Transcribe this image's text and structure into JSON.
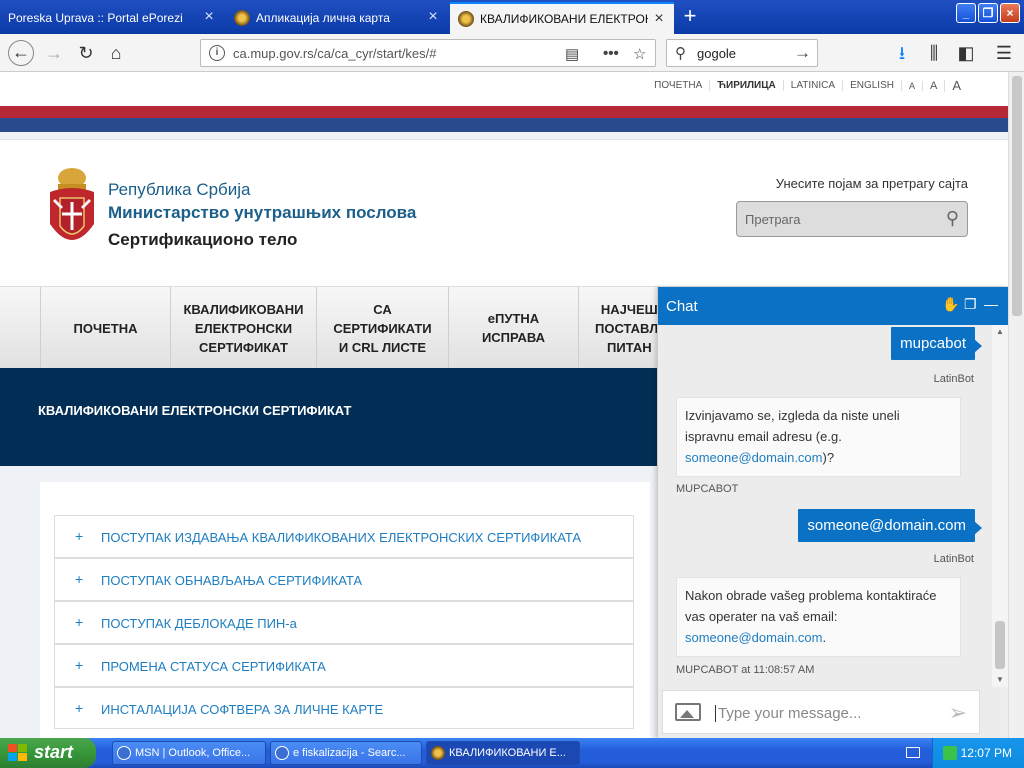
{
  "browser": {
    "tabs": [
      {
        "label": "Poreska Uprava :: Portal ePorezi",
        "active": false
      },
      {
        "label": "Апликација лична карта",
        "active": false
      },
      {
        "label": "КВАЛИФИКОВАНИ ЕЛЕКТРОНСКИ",
        "active": true
      }
    ],
    "url": "ca.mup.gov.rs/ca/ca_cyr/start/kes/#",
    "search_value": "gogole"
  },
  "page": {
    "toplinks": [
      "ПОЧЕТНА",
      "ЋИРИЛИЦА",
      "LATINICA",
      "ENGLISH",
      "A",
      "A",
      "A"
    ],
    "header": {
      "line1": "Република Србија",
      "line2": "Министарство унутрашњих послова",
      "line3": "Сертификационо тело"
    },
    "site_search": {
      "label": "Унесите појам за претрагу сајта",
      "placeholder": "Претрага"
    },
    "nav": [
      "ПОЧЕТНА",
      "КВАЛИФИКОВАНИ\nЕЛЕКТРОНСКИ\nСЕРТИФИКАТ",
      "СА\nСЕРТИФИКАТИ\nИ CRL ЛИСТЕ",
      "еПУТНА\nИСПРАВА",
      "НАЈЧЕШ\nПОСТАВЉ\nПИТАН"
    ],
    "banner_title": "КВАЛИФИКОВАНИ ЕЛЕКТРОНСКИ СЕРТИФИКАТ",
    "accordion": [
      "ПОСТУПАК ИЗДАВАЊА КВАЛИФИКОВАНИХ ЕЛЕКТРОНСКИХ СЕРТИФИКАТА",
      "ПОСТУПАК ОБНАВЉАЊА СЕРТИФИКАТА",
      "ПОСТУПАК ДЕБЛОКАДЕ ПИН-а",
      "ПРОМЕНА СТАТУСА СЕРТИФИКАТА",
      "ИНСТАЛАЦИЈА СОФТВЕРА ЗА ЛИЧНЕ КАРТЕ"
    ],
    "accordion_symbol": "+"
  },
  "chat": {
    "title": "Chat",
    "messages": [
      {
        "from": "me",
        "text": "mupcabot",
        "meta": "LatinBot"
      },
      {
        "from": "bot",
        "text": "Izvinjavamo se, izgleda da niste uneli ispravnu email adresu (e.g.",
        "link": "someone@domain.com",
        "tail": ")?",
        "meta": "MUPCABOT"
      },
      {
        "from": "me",
        "text": "someone@domain.com",
        "meta": "LatinBot"
      },
      {
        "from": "bot",
        "text": "Nakon obrade vašeg problema kontaktiraće vas operater na vaš email:",
        "link": "someone@domain.com",
        "tail": ".",
        "meta": "MUPCABOT at 11:08:57 AM"
      }
    ],
    "input_placeholder": "Type your message..."
  },
  "taskbar": {
    "start_label": "start",
    "tasks": [
      {
        "label": "MSN | Outlook, Office...",
        "active": false
      },
      {
        "label": "e fiskalizacija - Searc...",
        "active": false
      },
      {
        "label": "КВАЛИФИКОВАНИ Е...",
        "active": true
      }
    ],
    "clock": "12:07 PM"
  },
  "colors": {
    "chat_blue": "#0a71c5",
    "banner_navy": "#022d54",
    "link_blue": "#1e7ec1",
    "flag_red": "#b52835",
    "flag_blue": "#2a4a8e"
  }
}
